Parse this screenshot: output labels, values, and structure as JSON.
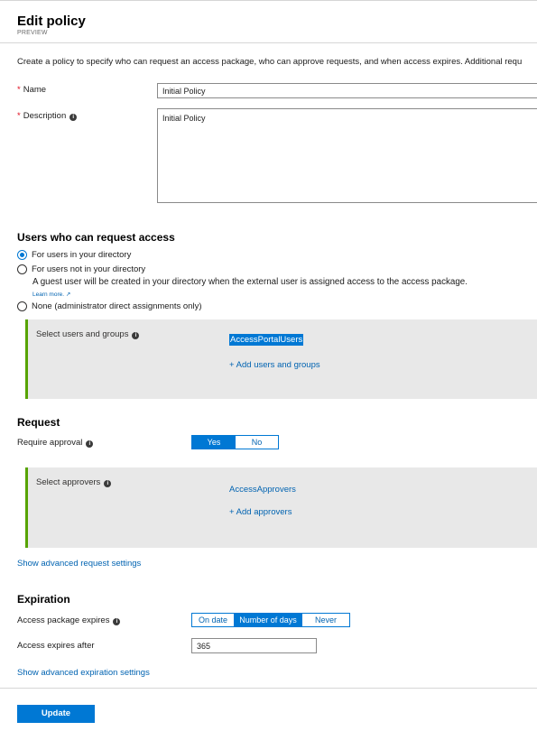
{
  "header": {
    "title": "Edit policy",
    "subtitle": "PREVIEW"
  },
  "intro": "Create a policy to specify who can request an access package, who can approve requests, and when access expires. Additional requ",
  "name_field": {
    "label": "Name",
    "value": "Initial Policy"
  },
  "description_field": {
    "label": "Description",
    "value": "Initial Policy"
  },
  "users_section": {
    "title": "Users who can request access",
    "options": [
      {
        "label": "For users in your directory",
        "checked": true
      },
      {
        "label": "For users not in your directory",
        "checked": false
      },
      {
        "label": "None (administrator direct assignments only)",
        "checked": false
      }
    ],
    "guest_note": "A guest user will be created in your directory when the external user is assigned access to the access package.",
    "learn_more": "Learn more.",
    "panel": {
      "label": "Select users and groups",
      "selected": "AccessPortalUsers",
      "add_link": "+ Add users and groups"
    }
  },
  "request_section": {
    "title": "Request",
    "approval_label": "Require approval",
    "approval_options": [
      "Yes",
      "No"
    ],
    "approval_selected": "Yes",
    "panel": {
      "label": "Select approvers",
      "selected": "AccessApprovers",
      "add_link": "+ Add approvers"
    },
    "advanced_link": "Show advanced request settings"
  },
  "expiration_section": {
    "title": "Expiration",
    "expires_label": "Access package expires",
    "expires_options": [
      "On date",
      "Number of days",
      "Never"
    ],
    "expires_selected": "Number of days",
    "after_label": "Access expires after",
    "after_value": "365",
    "advanced_link": "Show advanced expiration settings"
  },
  "footer": {
    "update_label": "Update"
  },
  "colors": {
    "accent": "#0078d4",
    "link": "#0063b1",
    "panel_border": "#57a300",
    "required": "#e00b1c"
  }
}
